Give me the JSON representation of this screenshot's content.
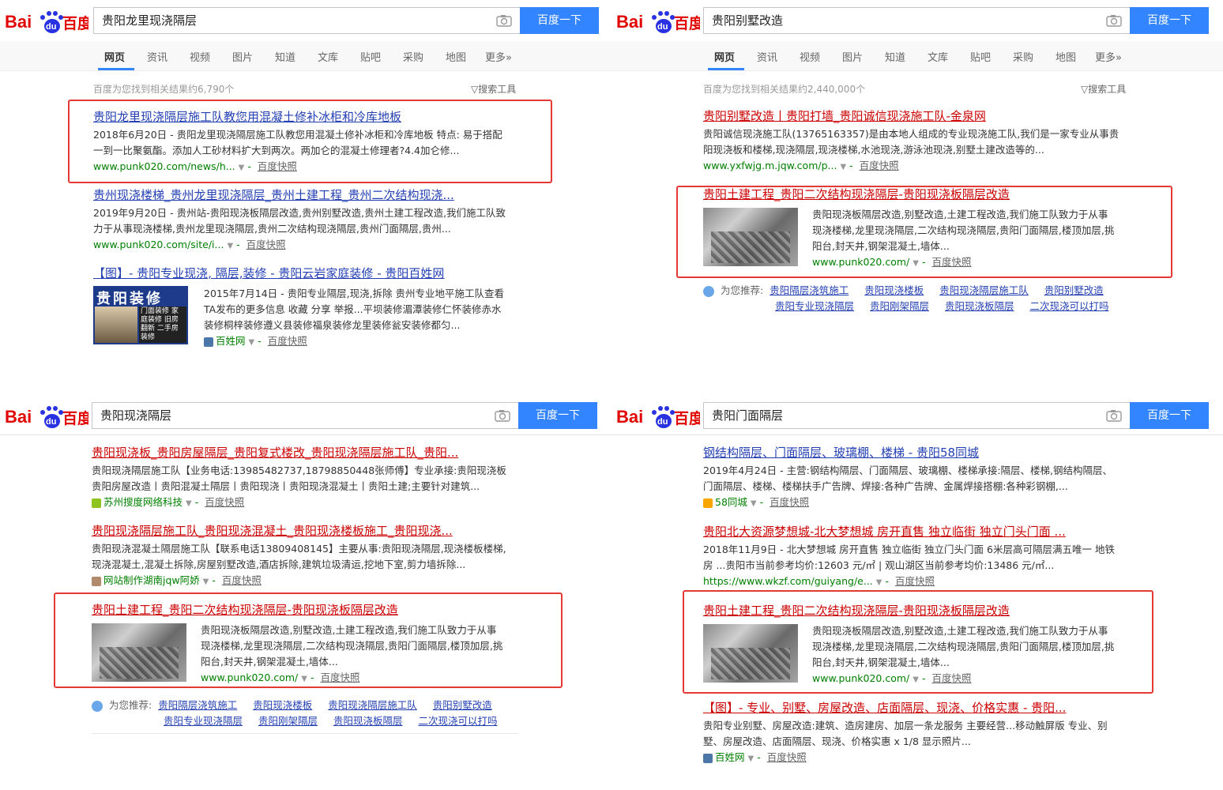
{
  "brand": {
    "logo_text": "Bai",
    "logo_du": "du",
    "logo_cn": "百度",
    "button": "百度一下"
  },
  "nav": [
    "网页",
    "资讯",
    "视频",
    "图片",
    "知道",
    "文库",
    "贴吧",
    "采购",
    "地图",
    "更多»"
  ],
  "q1": {
    "query": "贵阳龙里现浇隔层",
    "stats": "百度为您找到相关结果约6,790个",
    "tools": "搜索工具",
    "results": [
      {
        "title": "贵阳龙里现浇隔层施工队教您用混凝土修补冰柜和冷库地板",
        "line1": "2018年6月20日 - 贵阳龙里现浇隔层施工队教您用混凝土修补冰柜和冷库地板 特点: 易于搭配",
        "line2": "一到一比聚氨酯。添加人工砂材料扩大到两次。两加仑的混凝土修理者?4.4加仑修...",
        "url": "www.punk020.com/news/h...",
        "snap": "百度快照"
      },
      {
        "title": "贵州现浇楼梯_贵州龙里现浇隔层_贵州土建工程_贵州二次结构现浇...",
        "line1": "2019年9月20日 - 贵州站-贵阳现浇板隔层改造,贵州别墅改造,贵州土建工程改造,我们施工队致",
        "line2": "力于从事现浇楼梯,贵州龙里现浇隔层,贵州二次结构现浇隔层,贵州门面隔层,贵州...",
        "url": "www.punk020.com/site/i...",
        "snap": "百度快照"
      },
      {
        "title": "【图】- 贵阳专业现浇, 隔层,装修 - 贵阳云岩家庭装修 - 贵阳百姓网",
        "line1": "2015年7月14日 - 贵阳专业隔层,现浇,拆除 贵州专业地平施工队查看",
        "line2": "TA发布的更多信息 收藏 分享 举报...平坝装修湄潭装修仁怀装修赤水",
        "line3": "装修桐梓装修遵义县装修福泉装修龙里装修瓮安装修都匀...",
        "url": "百姓网",
        "snap": "百度快照",
        "ad_big": "贵阳装修",
        "ad_small": "门面装修 家庭装修 旧房翻新 二手房装修"
      }
    ]
  },
  "q2": {
    "query": "贵阳别墅改造",
    "stats": "百度为您找到相关结果约2,440,000个",
    "tools": "搜索工具",
    "results": [
      {
        "title": "贵阳别墅改造丨贵阳打墙_贵阳诚信现浇施工队-金泉网",
        "line1": "贵阳诚信现浇施工队(13765163357)是由本地人组成的专业现浇施工队,我们是一家专业从事贵",
        "line2": "阳现浇板和楼梯,现浇隔层,现浇楼梯,水池现浇,游泳池现浇,别墅土建改造等的...",
        "url": "www.yxfwjg.m.jqw.com/p...",
        "snap": "百度快照"
      },
      {
        "title": "贵阳土建工程_贵阳二次结构现浇隔层-贵阳现浇板隔层改造",
        "line1": "贵阳现浇板隔层改造,别墅改造,土建工程改造,我们施工队致力于从事",
        "line2": "现浇楼梯,龙里现浇隔层,二次结构现浇隔层,贵阳门面隔层,楼顶加层,挑",
        "line3": "阳台,封天井,钢架混凝土,墙体...",
        "url": "www.punk020.com/",
        "snap": "百度快照"
      }
    ],
    "recommend_label": "为您推荐:",
    "recommend": [
      "贵阳隔层浇筑施工",
      "贵阳现浇楼板",
      "贵阳现浇隔层施工队",
      "贵阳别墅改造",
      "贵阳专业现浇隔层",
      "贵阳刚架隔层",
      "贵阳现浇板隔层",
      "二次现浇可以打吗"
    ]
  },
  "q3": {
    "query": "贵阳现浇隔层",
    "results": [
      {
        "title": "贵阳现浇板_贵阳房屋隔层_贵阳复式楼改_贵阳现浇隔层施工队_贵阳...",
        "line1": "贵阳现浇隔层施工队【业务电话:13985482737,18798850448张师傅】专业承接:贵阳现浇板",
        "line2": "贵阳房屋改造丨贵阳混凝土隔层丨贵阳现浇丨贵阳现浇混凝土丨贵阳土建;主要针对建筑...",
        "url": "苏州搜度网络科技",
        "snap": "百度快照"
      },
      {
        "title": "贵阳现浇隔层施工队_贵阳现浇混凝土_贵阳现浇楼板施工_贵阳现浇...",
        "line1": "贵阳现浇混凝土隔层施工队【联系电话13809408145】主要从事:贵阳现浇隔层,现浇楼板楼梯,",
        "line2": "现浇混凝土,混凝土拆除,房屋别墅改造,酒店拆除,建筑垃圾清运,挖地下室,剪力墙拆除...",
        "url": "网站制作湖南jqw阿娇",
        "snap": "百度快照"
      },
      {
        "title": "贵阳土建工程_贵阳二次结构现浇隔层-贵阳现浇板隔层改造",
        "line1": "贵阳现浇板隔层改造,别墅改造,土建工程改造,我们施工队致力于从事",
        "line2": "现浇楼梯,龙里现浇隔层,二次结构现浇隔层,贵阳门面隔层,楼顶加层,挑",
        "line3": "阳台,封天井,钢架混凝土,墙体...",
        "url": "www.punk020.com/",
        "snap": "百度快照"
      }
    ],
    "recommend_label": "为您推荐:",
    "recommend": [
      "贵阳隔层浇筑施工",
      "贵阳现浇楼板",
      "贵阳现浇隔层施工队",
      "贵阳别墅改造",
      "贵阳专业现浇隔层",
      "贵阳刚架隔层",
      "贵阳现浇板隔层",
      "二次现浇可以打吗"
    ]
  },
  "q4": {
    "query": "贵阳门面隔层",
    "results": [
      {
        "title": "钢结构隔层、门面隔层、玻璃棚、楼梯 - 贵阳58同城",
        "line1": "2019年4月24日 - 主营:钢结构隔层、门面隔层、玻璃棚、楼梯承接:隔层、楼梯,钢结构隔层、",
        "line2": "门面隔层、楼梯、楼梯扶手广告牌、焊接:各种广告牌、金属焊接搭棚:各种彩钢棚,...",
        "url": "58同城",
        "snap": "百度快照"
      },
      {
        "title": "贵阳北大资源梦想城-北大梦想城 房开直售 独立临街 独立门头门面 ...",
        "line1": "2018年11月9日 - 北大梦想城 房开直售 独立临街 独立门头门面 6米层高可隔层满五唯一 地铁",
        "line2": "房 ...贵阳市当前参考均价:12603 元/㎡ | 观山湖区当前参考均价:13486 元/㎡...",
        "url": "https://www.wkzf.com/guiyang/e...",
        "snap": "百度快照"
      },
      {
        "title": "贵阳土建工程_贵阳二次结构现浇隔层-贵阳现浇板隔层改造",
        "line1": "贵阳现浇板隔层改造,别墅改造,土建工程改造,我们施工队致力于从事",
        "line2": "现浇楼梯,龙里现浇隔层,二次结构现浇隔层,贵阳门面隔层,楼顶加层,挑",
        "line3": "阳台,封天井,钢架混凝土,墙体...",
        "url": "www.punk020.com/",
        "snap": "百度快照"
      },
      {
        "title": "【图】- 专业、别墅、房屋改造、店面隔层、现浇、价格实惠 - 贵阳...",
        "line1": "贵阳专业别墅、房屋改造:建筑、造房建房、加层一条龙服务 主要经营...移动触屏版 专业、别",
        "line2": "墅、房屋改造、店面隔层、现浇、价格实惠 x 1/8 显示照片...",
        "url": "百姓网",
        "snap": "百度快照"
      }
    ]
  }
}
